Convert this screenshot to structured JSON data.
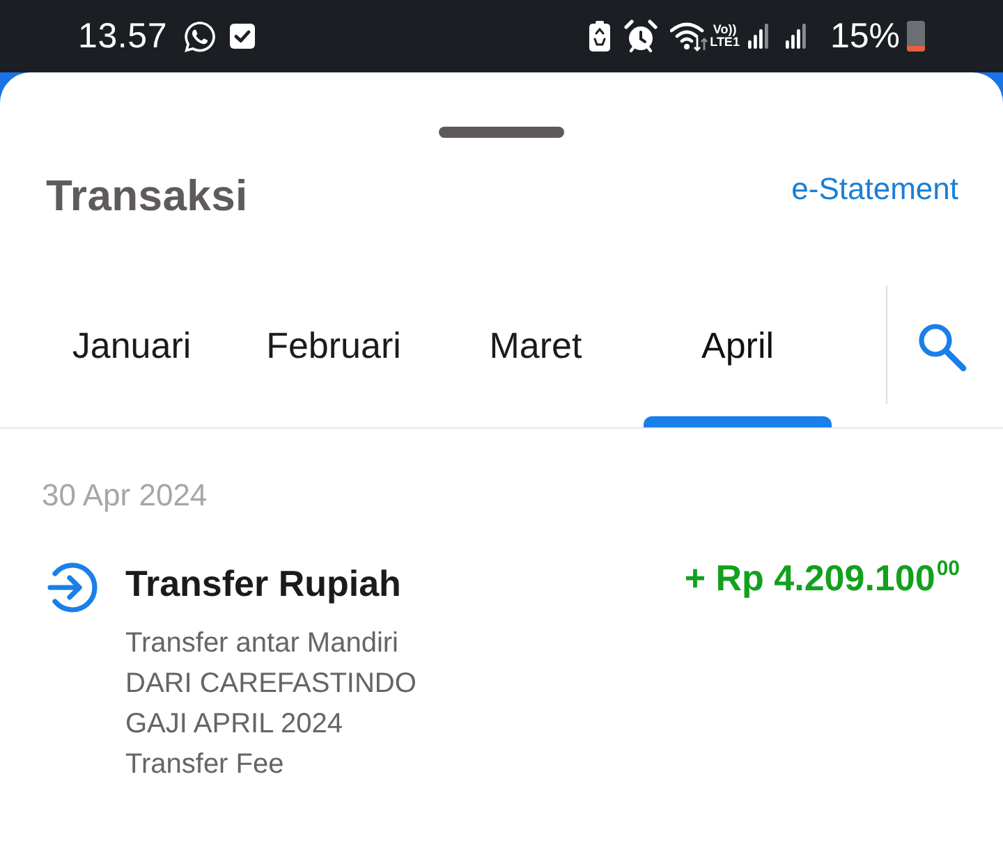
{
  "status_bar": {
    "time": "13.57",
    "volte": "Vo))",
    "network": "LTE1",
    "battery": "15%"
  },
  "sheet": {
    "title": "Transaksi",
    "link": "e-Statement"
  },
  "tabs": [
    {
      "label": "Januari",
      "selected": false
    },
    {
      "label": "Februari",
      "selected": false
    },
    {
      "label": "Maret",
      "selected": false
    },
    {
      "label": "April",
      "selected": true
    }
  ],
  "transactions": [
    {
      "date": "30 Apr 2024",
      "items": [
        {
          "kind": "incoming",
          "title": "Transfer Rupiah",
          "amount": "+ Rp 4.209.100$^{00}$",
          "details": [
            "Transfer antar Mandiri",
            "DARI CAREFASTINDO",
            "GAJI APRIL 2024",
            "Transfer Fee"
          ]
        }
      ]
    }
  ]
}
